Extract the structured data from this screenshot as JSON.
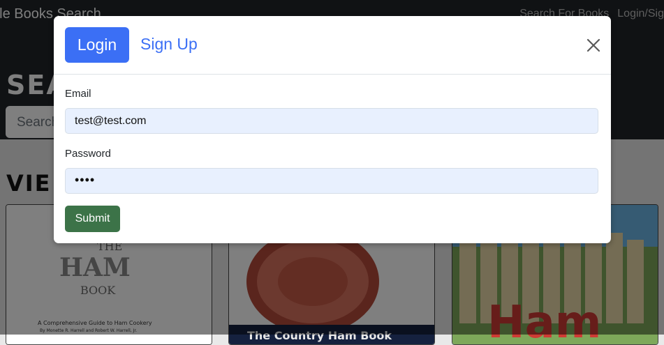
{
  "navbar": {
    "brand": "gle Books Search",
    "links": [
      "Search For Books",
      "Login/Sig"
    ]
  },
  "hero": {
    "title": "SEA",
    "search_placeholder": "Search"
  },
  "results": {
    "title": "VIE",
    "books": [
      {
        "cover_lines": [
          "THE",
          "HAM",
          "BOOK",
          "A Comprehensive Guide to Ham Cookery",
          "By Monette R. Harrell and Robert W. Harrell, Jr."
        ]
      },
      {
        "cover_lines": [
          "The Country Ham Book"
        ]
      },
      {
        "cover_lines": [
          "Ham"
        ]
      }
    ]
  },
  "modal": {
    "tabs": {
      "login": "Login",
      "signup": "Sign Up"
    },
    "close_icon": "close-icon",
    "email_label": "Email",
    "email_value": "test@test.com",
    "password_label": "Password",
    "password_value": "••••",
    "submit_label": "Submit"
  },
  "colors": {
    "primary": "#3b6ff5",
    "submit": "#3c7348",
    "navbar": "#212529",
    "input_bg": "#e8f0fe"
  }
}
